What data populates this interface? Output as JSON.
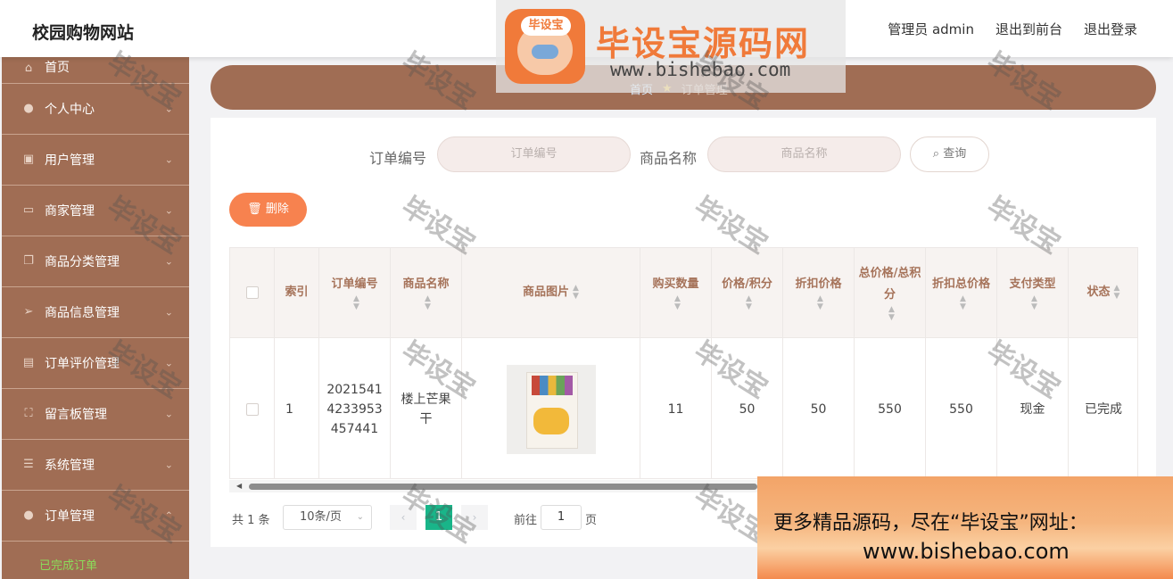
{
  "header": {
    "site_title": "校园购物网站",
    "user_label": "管理员 admin",
    "to_front": "退出到前台",
    "logout": "退出登录"
  },
  "watermark_banner": {
    "logo_text": "毕设宝",
    "title": "毕设宝源码网",
    "url": "www.bishebao.com"
  },
  "watermark_text": "毕设宝",
  "sidebar": {
    "items": [
      {
        "label": "首页",
        "icon": "home-icon"
      },
      {
        "label": "个人中心",
        "icon": "user-icon"
      },
      {
        "label": "用户管理",
        "icon": "clipboard-icon"
      },
      {
        "label": "商家管理",
        "icon": "chat-icon"
      },
      {
        "label": "商品分类管理",
        "icon": "copy-icon"
      },
      {
        "label": "商品信息管理",
        "icon": "send-icon"
      },
      {
        "label": "订单评价管理",
        "icon": "ticket-icon"
      },
      {
        "label": "留言板管理",
        "icon": "fullscreen-icon"
      },
      {
        "label": "系统管理",
        "icon": "list-icon"
      },
      {
        "label": "订单管理",
        "icon": "bulb-icon"
      }
    ],
    "active_sub": "已完成订单"
  },
  "breadcrumb": {
    "home": "首页",
    "current": "订单管理"
  },
  "search": {
    "order_no_label": "订单编号",
    "order_no_placeholder": "订单编号",
    "product_name_label": "商品名称",
    "product_name_placeholder": "商品名称",
    "query_button": "查询"
  },
  "toolbar": {
    "delete_button": "删除"
  },
  "table": {
    "headers": {
      "index": "索引",
      "order_no": "订单编号",
      "product_name": "商品名称",
      "product_image": "商品图片",
      "quantity": "购买数量",
      "price": "价格/积分",
      "discount_price": "折扣价格",
      "total": "总价格/总积分",
      "discount_total": "折扣总价格",
      "pay_type": "支付类型",
      "status": "状态"
    },
    "rows": [
      {
        "index": "1",
        "order_no": "2021541 4233953 457441",
        "product_name": "楼上芒果干",
        "quantity": "11",
        "price": "50",
        "discount_price": "50",
        "total": "550",
        "discount_total": "550",
        "pay_type": "现金",
        "status": "已完成"
      }
    ]
  },
  "pagination": {
    "total": "共 1 条",
    "page_size": "10条/页",
    "current_page": "1",
    "goto_label": "前往",
    "goto_value": "1",
    "goto_unit": "页"
  },
  "ad": {
    "line1": "更多精品源码，尽在“毕设宝”网址：",
    "line2": "www.bishebao.com"
  },
  "colors": {
    "sidebar": "#a06d54",
    "accent_orange": "#f7824f",
    "pager_active": "#19b589",
    "active_sub": "#8bdc5a"
  }
}
